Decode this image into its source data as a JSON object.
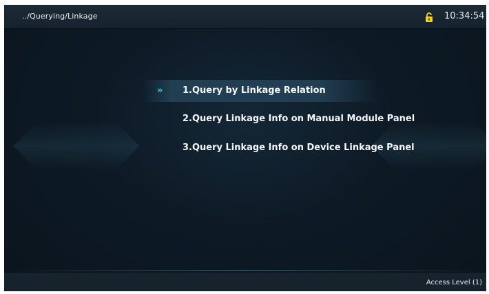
{
  "header": {
    "breadcrumb": "../Querying/Linkage",
    "time": "10:34:54",
    "lock_icon": "unlocked-padlock-icon"
  },
  "menu": {
    "selected_marker": "»",
    "items": [
      {
        "label": "1.Query by Linkage Relation",
        "selected": true
      },
      {
        "label": "2.Query Linkage Info on Manual Module Panel",
        "selected": false
      },
      {
        "label": "3.Query Linkage Info on Device Linkage Panel",
        "selected": false
      }
    ]
  },
  "footer": {
    "access_level": "Access Level (1)"
  },
  "colors": {
    "accent": "#2fd3e6",
    "lock": "#f3d21a",
    "text": "#f4f7fa"
  }
}
